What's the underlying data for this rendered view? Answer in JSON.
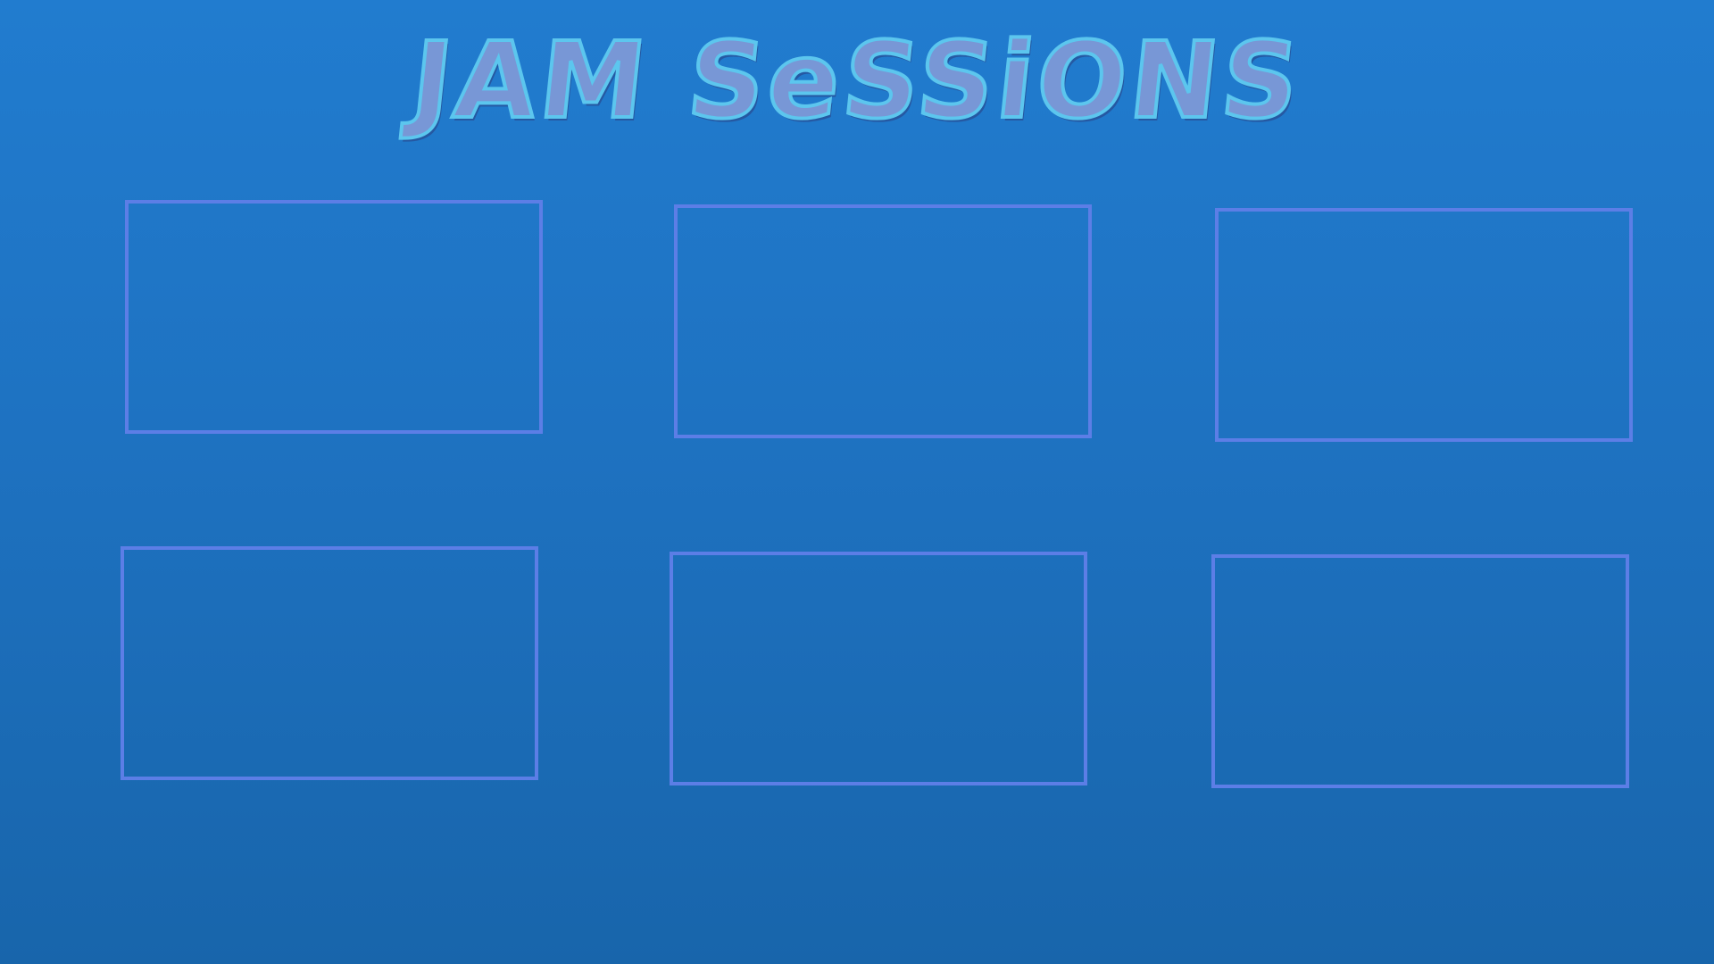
{
  "slide": {
    "title": "JAM SeSSiONS",
    "accent_color": "#5c7ee6",
    "title_fill_color": "#7897d6",
    "title_outline_color": "#5cc6ee",
    "background_top": "#217ccf",
    "background_bottom": "#1865ab"
  },
  "slots_count": 6
}
